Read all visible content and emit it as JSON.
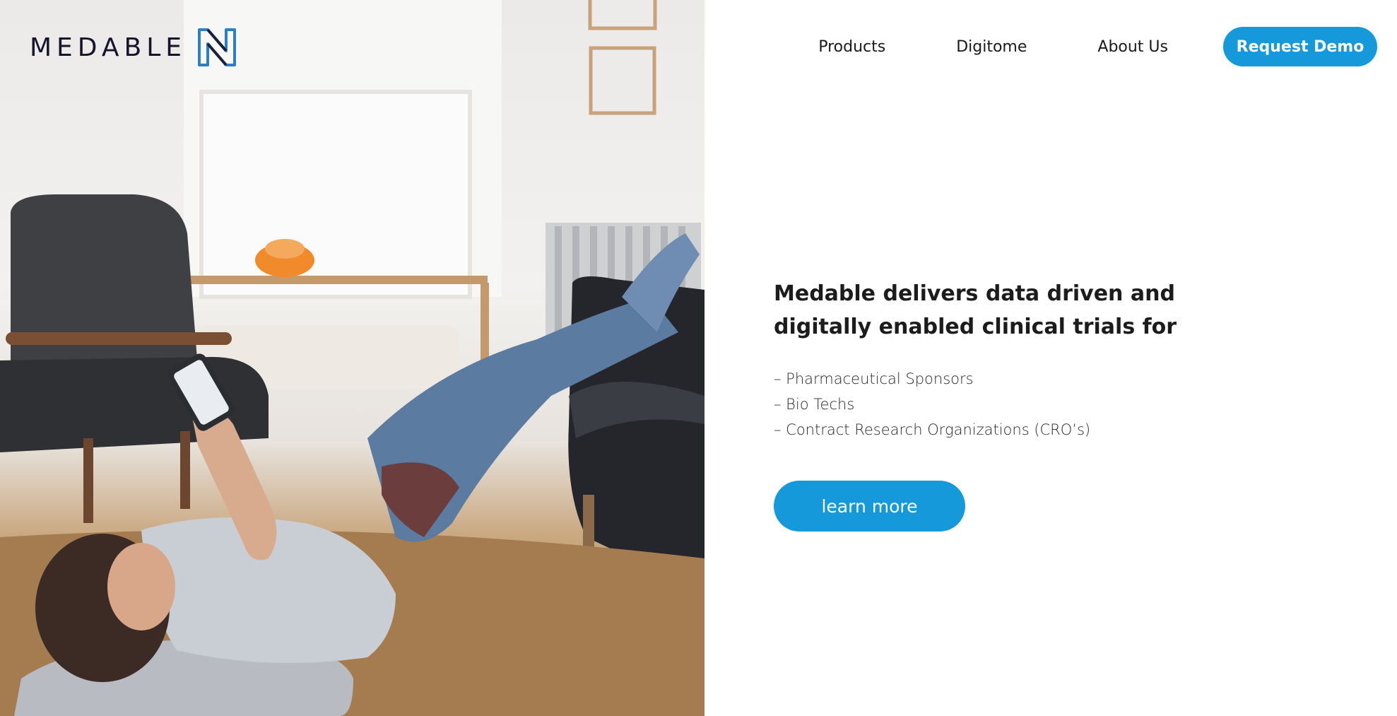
{
  "brand": {
    "name": "MEDABLE",
    "colors": {
      "accent": "#1699db",
      "logo_mark": "#2d7fc1",
      "text": "#14142a"
    }
  },
  "nav": {
    "links": [
      "Products",
      "Digitome",
      "About Us"
    ],
    "cta_label": "Request Demo"
  },
  "hero": {
    "image_icon": "hero-photo-woman-on-floor-with-phone",
    "headline": "Medable delivers data driven and digitally enabled clinical trials for",
    "audience": [
      "– Pharmaceutical Sponsors",
      "– Bio Techs",
      "– Contract Research Organizations (CRO’s)"
    ],
    "cta_label": "learn more"
  }
}
